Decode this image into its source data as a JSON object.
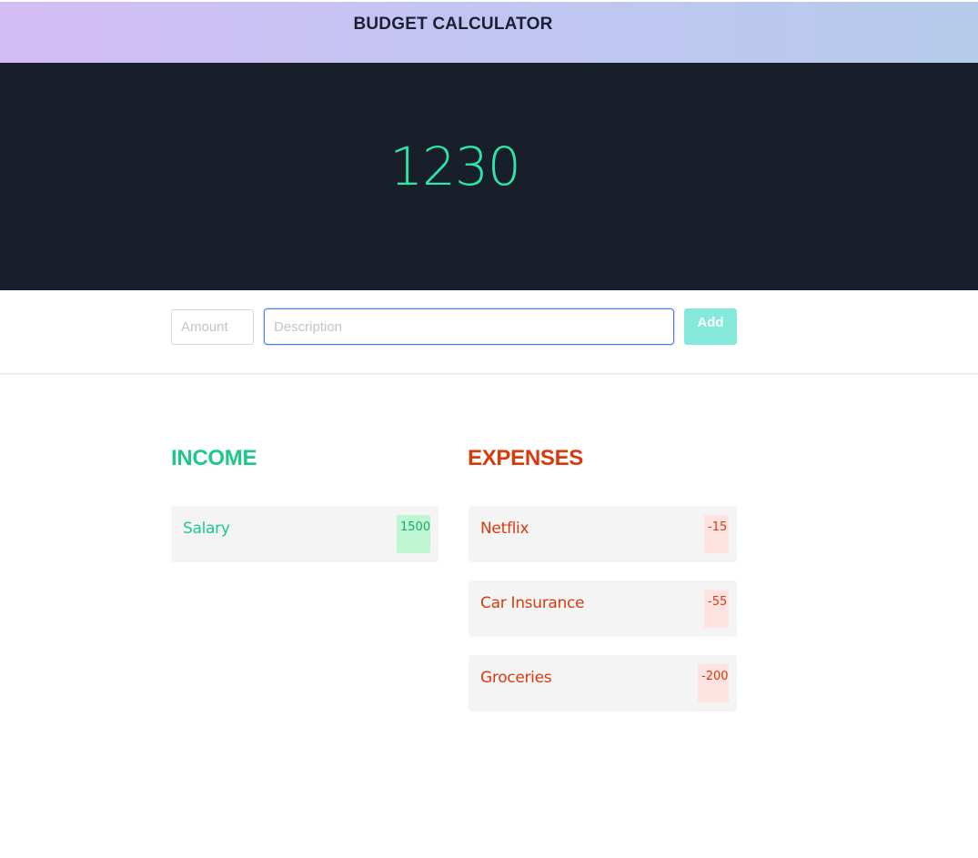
{
  "header": {
    "title": "BUDGET CALCULATOR"
  },
  "balance": {
    "value": "1230"
  },
  "form": {
    "amount_placeholder": "Amount",
    "amount_value": "",
    "description_placeholder": "Description",
    "description_value": "",
    "add_label": "Add"
  },
  "income": {
    "title": "INCOME",
    "items": [
      {
        "label": "Salary",
        "amount": "1500"
      }
    ]
  },
  "expenses": {
    "title": "EXPENSES",
    "items": [
      {
        "label": "Netflix",
        "amount": "-15"
      },
      {
        "label": "Car Insurance",
        "amount": "-55"
      },
      {
        "label": "Groceries",
        "amount": "-200"
      }
    ]
  },
  "colors": {
    "income": "#1cc98a",
    "expense": "#d93a0c",
    "balance": "#2be7a3",
    "panel": "#191e2b",
    "add_button": "#84e8da"
  }
}
